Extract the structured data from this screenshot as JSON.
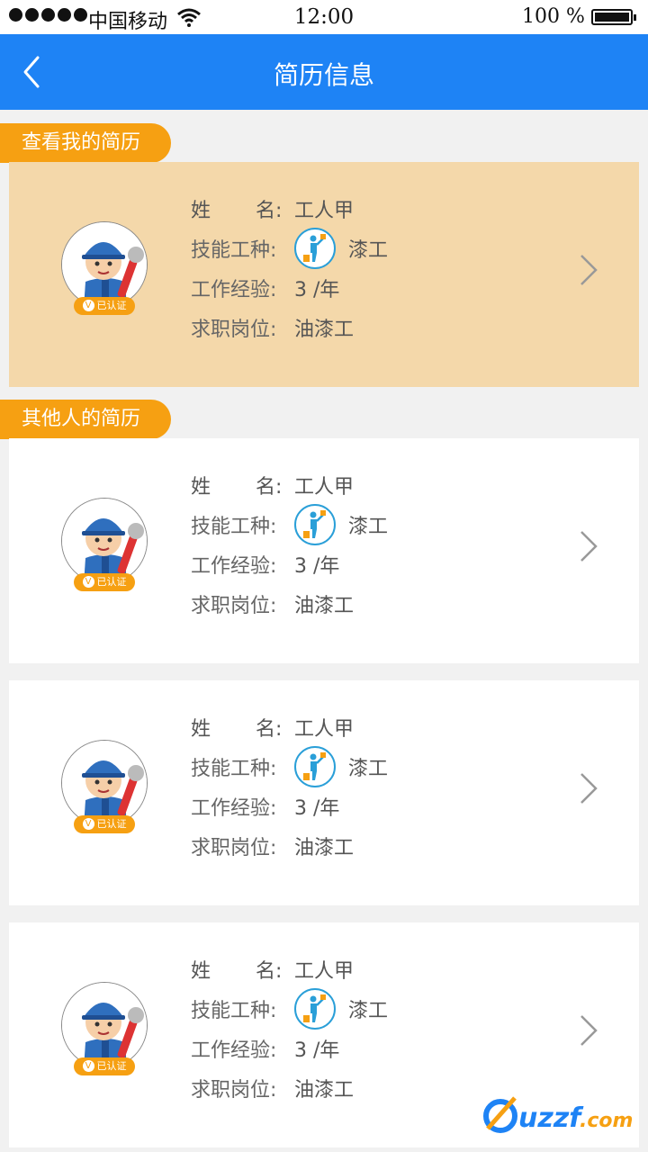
{
  "status_bar": {
    "carrier": "中国移动",
    "time": "12:00",
    "battery": "100 %"
  },
  "nav": {
    "title": "简历信息",
    "back_icon": "chevron-left-icon"
  },
  "sections": {
    "mine": "查看我的简历",
    "others": "其他人的简历"
  },
  "labels": {
    "name_a": "姓",
    "name_b": "名:",
    "skill": "技能工种:",
    "experience": "工作经验:",
    "position": "求职岗位:"
  },
  "badge_text": "已认证",
  "badge_v": "V",
  "resumes": [
    {
      "name": "工人甲",
      "skill": "漆工",
      "experience": "3 /年",
      "position": "油漆工"
    },
    {
      "name": "工人甲",
      "skill": "漆工",
      "experience": "3 /年",
      "position": "油漆工"
    },
    {
      "name": "工人甲",
      "skill": "漆工",
      "experience": "3 /年",
      "position": "油漆工"
    },
    {
      "name": "工人甲",
      "skill": "漆工",
      "experience": "3 /年",
      "position": "油漆工"
    }
  ],
  "colors": {
    "nav": "#1e83f5",
    "accent": "#f6a012",
    "mine_card": "#f4d8aa"
  },
  "watermark": "uzzf.com"
}
